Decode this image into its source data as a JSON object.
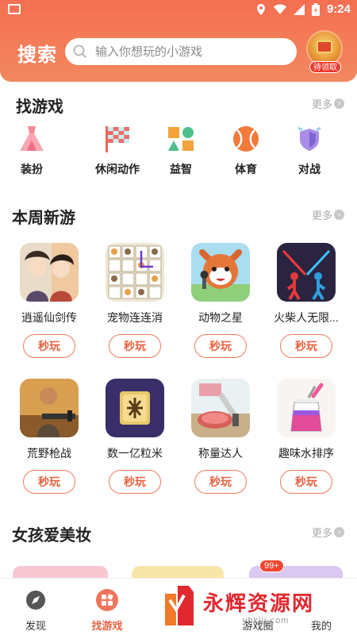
{
  "status": {
    "time": "9:24"
  },
  "header": {
    "title": "搜索",
    "search_placeholder": "输入你想玩的小游戏",
    "gift_badge": "待领取"
  },
  "find_section": {
    "title": "找游戏",
    "more": "更多",
    "categories": [
      {
        "label": "装扮",
        "icon": "dress-icon"
      },
      {
        "label": "休闲动作",
        "icon": "flag-icon"
      },
      {
        "label": "益智",
        "icon": "shapes-icon"
      },
      {
        "label": "体育",
        "icon": "ball-icon"
      },
      {
        "label": "对战",
        "icon": "shield-icon"
      }
    ]
  },
  "weekly_section": {
    "title": "本周新游",
    "more": "更多",
    "play_label": "秒玩",
    "games": [
      {
        "name": "逍遥仙剑传"
      },
      {
        "name": "宠物连连消"
      },
      {
        "name": "动物之星"
      },
      {
        "name": "火柴人无限..."
      },
      {
        "name": "荒野枪战"
      },
      {
        "name": "数一亿粒米"
      },
      {
        "name": "称量达人"
      },
      {
        "name": "趣味水排序"
      }
    ]
  },
  "beauty_section": {
    "title": "女孩爱美妆",
    "more": "更多"
  },
  "bottom_nav": {
    "tabs": [
      {
        "label": "发现"
      },
      {
        "label": "找游戏"
      },
      {
        "label": "游戏圈"
      },
      {
        "label": "我的"
      }
    ],
    "badge": "99+"
  },
  "watermark": {
    "text": "永辉资源网",
    "url": "yhkjjj.com"
  },
  "colors": {
    "accent": "#e8613f",
    "header_top": "#f46f52",
    "header_bottom": "#f3885f"
  }
}
